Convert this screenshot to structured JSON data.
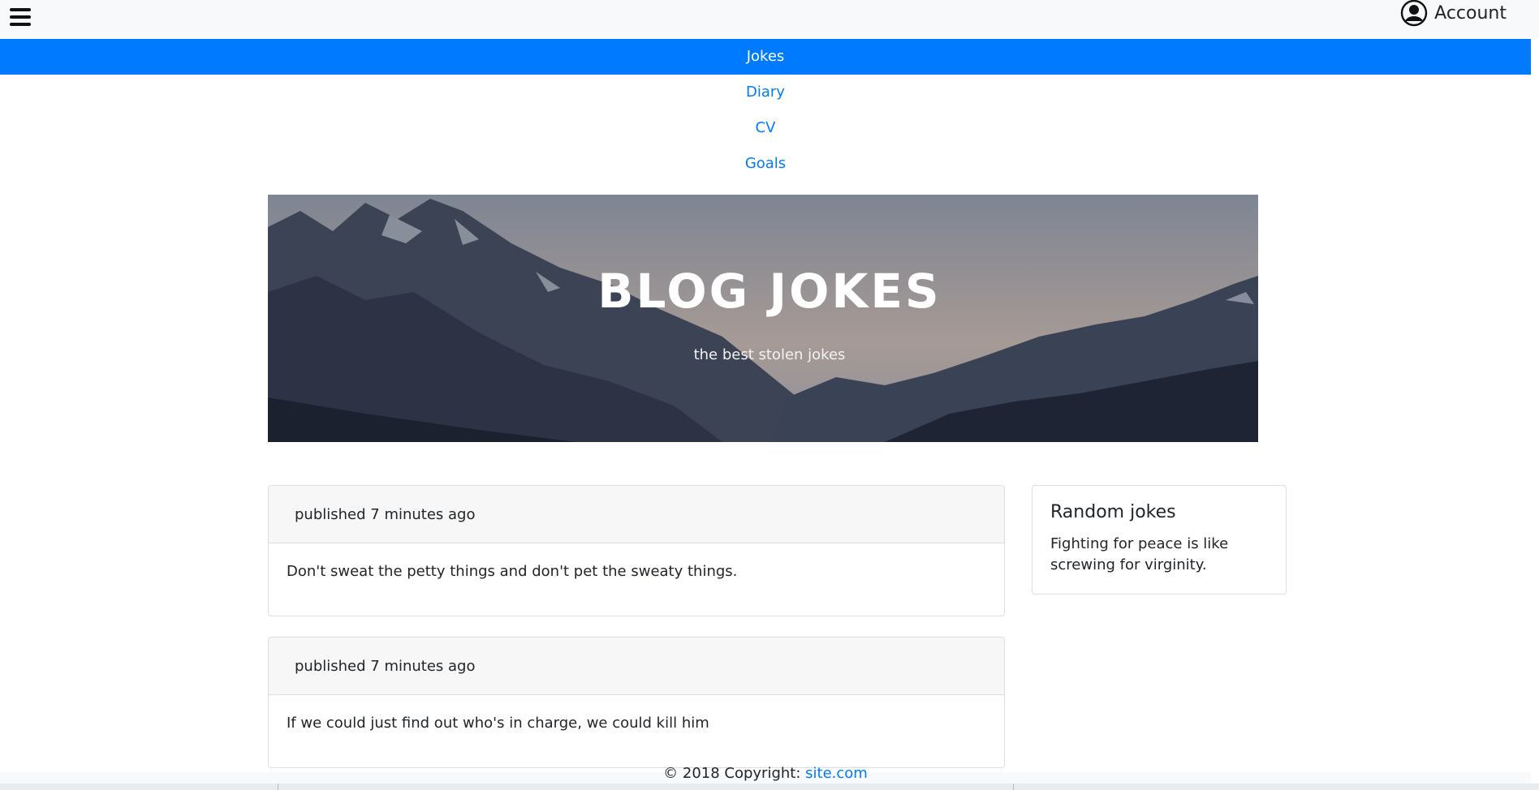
{
  "header": {
    "account_label": "Account"
  },
  "nav": {
    "items": [
      {
        "label": "Jokes"
      },
      {
        "label": "Diary"
      },
      {
        "label": "CV"
      },
      {
        "label": "Goals"
      }
    ]
  },
  "hero": {
    "title": "BLOG JOKES",
    "subtitle": "the best stolen jokes"
  },
  "posts": [
    {
      "meta": "published 7 minutes ago",
      "text": "Don't sweat the petty things and don't pet the sweaty things."
    },
    {
      "meta": "published 7 minutes ago",
      "text": "If we could just find out who's in charge, we could kill him"
    }
  ],
  "sidebar": {
    "title": "Random jokes",
    "text": "Fighting for peace is like screwing for virginity."
  },
  "footer": {
    "text": "© 2018 Copyright:",
    "link": "site.com"
  },
  "colors": {
    "accent": "#007bff",
    "topbar_bg": "#f8f9fa"
  }
}
